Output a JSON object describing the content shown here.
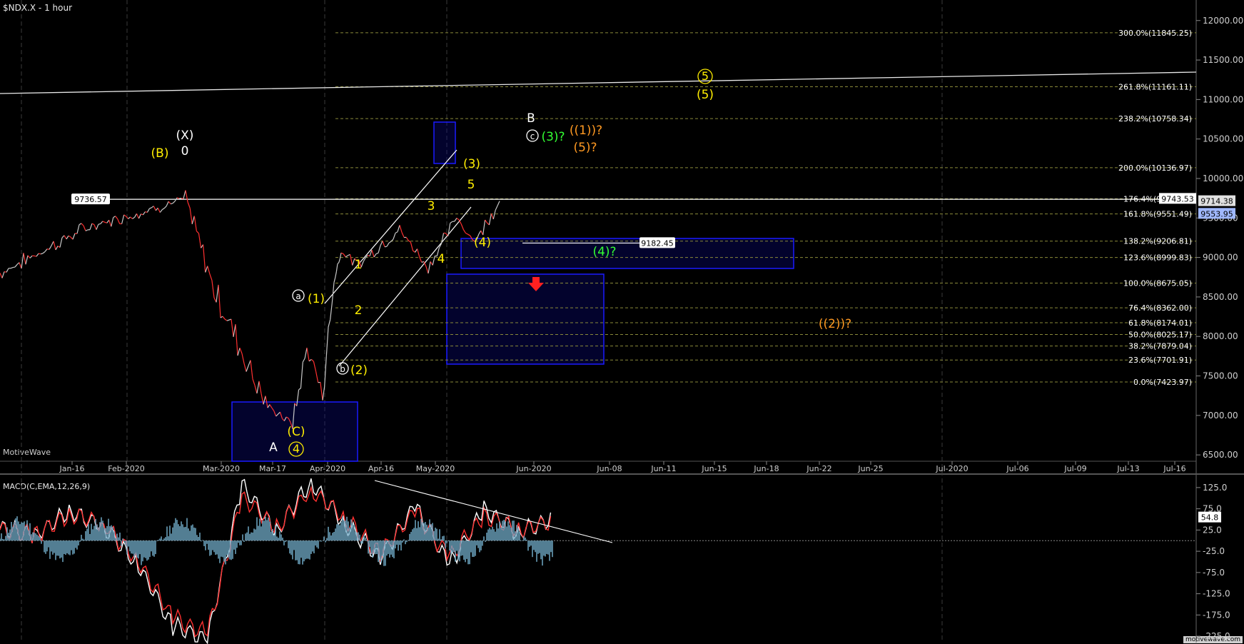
{
  "header": {
    "title": "$NDX.X - 1 hour"
  },
  "brand": "MotiveWave",
  "footer": "motivewave.com",
  "macd_title": "MACD(C,EMA,12,26,9)",
  "colors": {
    "bg": "#000000",
    "price": "#d0d0d0",
    "up": "#c8c8c8",
    "down": "#ff3030",
    "wave_yellow": "#ffee00",
    "wave_white": "#ffffff",
    "wave_green": "#33ff33",
    "wave_orange": "#ff9922",
    "box": "#0a0a80",
    "fib_line": "#8a8a3a",
    "macd": "#ffffff",
    "signal": "#ff3030",
    "hist": "#6fa8c4"
  },
  "chart_data": [
    {
      "type": "line",
      "title": "$NDX.X - 1 hour",
      "x_ticks": [
        "Jan-16",
        "Feb-2020",
        "Mar-2020",
        "Mar-17",
        "Apr-2020",
        "Apr-16",
        "May-2020",
        "Jun-2020",
        "Jun-08",
        "Jun-11",
        "Jun-15",
        "Jun-18",
        "Jun-22",
        "Jun-25",
        "Jul-2020",
        "Jul-06",
        "Jul-09",
        "Jul-13",
        "Jul-16"
      ],
      "y_ticks": [
        "12000.00",
        "11500.00",
        "11000.00",
        "10500.00",
        "10000.00",
        "9500.00",
        "9000.00",
        "8500.00",
        "8000.00",
        "7500.00",
        "7000.00",
        "6500.00"
      ],
      "ylim": [
        6420,
        12260
      ],
      "price_path": {
        "x": [
          0,
          1,
          2,
          3,
          3.6,
          4,
          4.6,
          5,
          5.2,
          5.5,
          5.6,
          6.3,
          6.9,
          7.3,
          7.7,
          8.3,
          8.6,
          8.9,
          9.3,
          10.3,
          11.3
        ],
        "y": [
          8800,
          9370,
          9736,
          8600,
          7100,
          6900,
          7850,
          7300,
          8700,
          9100,
          8900,
          9350,
          8880,
          9500,
          9200,
          9714,
          null,
          null,
          null,
          null,
          null
        ]
      },
      "price_labels": {
        "current": "9714.38",
        "sma": "9553.95",
        "hline": "9743.53"
      },
      "hlines": [
        {
          "label": "9736.57",
          "value": 9736.57
        },
        {
          "label": "9182.45",
          "value": 9182.45
        }
      ],
      "fib_levels": [
        {
          "label": "300.0%(11845.25)",
          "value": 11845.25
        },
        {
          "label": "261.8%(11161.11)",
          "value": 11161.11
        },
        {
          "label": "238.2%(10758.34)",
          "value": 10758.34
        },
        {
          "label": "200.0%(10136.97)",
          "value": 10136.97
        },
        {
          "label": "176.4%(9743.53)",
          "value": 9743.53
        },
        {
          "label": "161.8%(9551.49)",
          "value": 9551.49
        },
        {
          "label": "138.2%(9206.81)",
          "value": 9206.81
        },
        {
          "label": "123.6%(8999.83)",
          "value": 8999.83
        },
        {
          "label": "100.0%(8675.05)",
          "value": 8675.05
        },
        {
          "label": "76.4%(8362.00)",
          "value": 8362.0
        },
        {
          "label": "61.8%(8174.01)",
          "value": 8174.01
        },
        {
          "label": "50.0%(8025.17)",
          "value": 8025.17
        },
        {
          "label": "38.2%(7879.04)",
          "value": 7879.04
        },
        {
          "label": "23.6%(7701.91)",
          "value": 7701.91
        },
        {
          "label": "0.0%(7423.97)",
          "value": 7423.97
        }
      ],
      "annotations": [
        {
          "text": "(X)",
          "color": "white"
        },
        {
          "text": "0",
          "color": "white"
        },
        {
          "text": "(B)",
          "color": "yellow"
        },
        {
          "text": "A",
          "color": "white"
        },
        {
          "text": "(C)",
          "color": "yellow"
        },
        {
          "text": "4",
          "color": "yellow",
          "circled": true
        },
        {
          "text": "a",
          "color": "white",
          "circled": true
        },
        {
          "text": "(1)",
          "color": "yellow"
        },
        {
          "text": "b",
          "color": "white",
          "circled": true
        },
        {
          "text": "(2)",
          "color": "yellow"
        },
        {
          "text": "1",
          "color": "yellow"
        },
        {
          "text": "2",
          "color": "yellow"
        },
        {
          "text": "3",
          "color": "yellow"
        },
        {
          "text": "4",
          "color": "yellow"
        },
        {
          "text": "5",
          "color": "yellow"
        },
        {
          "text": "(3)",
          "color": "yellow"
        },
        {
          "text": "(4)",
          "color": "yellow"
        },
        {
          "text": "B",
          "color": "white"
        },
        {
          "text": "c",
          "color": "white",
          "circled": true
        },
        {
          "text": "(3)?",
          "color": "green"
        },
        {
          "text": "((1))?",
          "color": "orange"
        },
        {
          "text": "(5)?",
          "color": "orange"
        },
        {
          "text": "(4)?",
          "color": "green"
        },
        {
          "text": "((2))?",
          "color": "orange"
        },
        {
          "text": "5",
          "color": "yellow",
          "circled": true
        },
        {
          "text": "(5)",
          "color": "yellow"
        }
      ]
    },
    {
      "type": "line",
      "title": "MACD(C,EMA,12,26,9)",
      "y_ticks": [
        "125.0",
        "75.0",
        "25.0",
        "-25.0",
        "-75.0",
        "-125.0",
        "-175.0",
        "-225.0"
      ],
      "ylim": [
        -240,
        150
      ],
      "current_value": "54.8",
      "series": [
        {
          "name": "MACD",
          "values": [
            30,
            10,
            70,
            35,
            -60,
            -200,
            -235,
            130,
            20,
            140,
            40,
            -40,
            80,
            -60,
            75,
            20,
            55
          ]
        },
        {
          "name": "Signal",
          "values": [
            25,
            15,
            60,
            40,
            -50,
            -180,
            -220,
            100,
            30,
            120,
            50,
            -30,
            70,
            -40,
            60,
            25,
            45
          ]
        }
      ]
    }
  ]
}
